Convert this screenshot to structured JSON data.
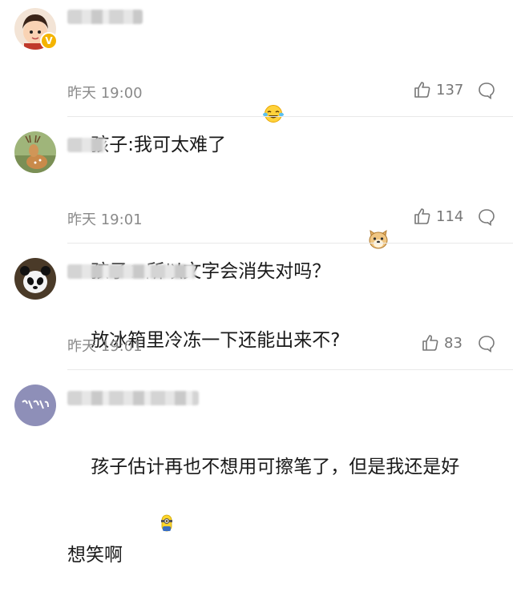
{
  "comments": [
    {
      "text": "孩子:我可太难了",
      "emoji": "laugh-cry-emoji",
      "time": "昨天 19:00",
      "likes": "137",
      "verified": true
    },
    {
      "text": "孩子：所以文字会消失对吗？",
      "emoji": "doge-emoji",
      "time": "昨天 19:01",
      "likes": "114",
      "verified": false
    },
    {
      "text": "放冰箱里冷冻一下还能出来不?",
      "emoji": "",
      "time": "昨天 19:01",
      "likes": "83",
      "verified": false
    },
    {
      "text": "孩子估计再也不想用可擦笔了，但是我还是好\n想笑啊",
      "emoji": "minion-emoji",
      "time": "",
      "likes": "",
      "verified": false
    }
  ],
  "colors": {
    "divider": "#e9e9e9",
    "meta_text": "#8a8a8a",
    "verified_badge": "#f4b400"
  }
}
